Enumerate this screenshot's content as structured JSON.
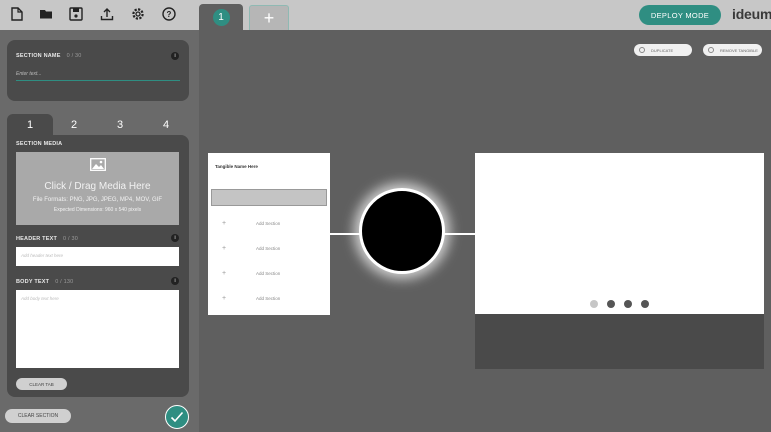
{
  "toolbar": {
    "icons": [
      "new-file-icon",
      "open-folder-icon",
      "save-icon",
      "upload-icon",
      "settings-icon",
      "help-icon"
    ],
    "active_tab": "1",
    "add_tab": "+",
    "deploy_label": "DEPLOY MODE",
    "logo": "ideum"
  },
  "section": {
    "name_label": "SECTION NAME",
    "name_count": "0 / 30",
    "name_placeholder": "Enter text...",
    "tabs": [
      "1",
      "2",
      "3",
      "4"
    ],
    "active_tab_index": 0
  },
  "media": {
    "label": "SECTION MEDIA",
    "title": "Click / Drag Media Here",
    "formats": "File Formats: PNG, JPG, JPEG, MP4, MOV, GIF",
    "dimensions": "Expected Dimensions: 960 x 540 pixels"
  },
  "header_text": {
    "label": "HEADER TEXT",
    "count": "0 / 30",
    "placeholder": "Add header text here"
  },
  "body_text": {
    "label": "BODY TEXT",
    "count": "0 / 130",
    "placeholder": "Add body text here"
  },
  "buttons": {
    "clear_tab": "CLEAR TAB",
    "clear_section": "CLEAR SECTION"
  },
  "canvas": {
    "duplicate": "DUPLICATE",
    "remove": "REMOVE TANGIBLE",
    "toggle_title": "Tangible Name Here",
    "add_sections": [
      "Add Section",
      "Add Section",
      "Add Section",
      "Add Section"
    ],
    "pagination": {
      "count": 4,
      "active": 0
    }
  },
  "colors": {
    "accent": "#2f8e82",
    "topbar": "#c7c7c7",
    "panel": "#4a4a4a"
  }
}
